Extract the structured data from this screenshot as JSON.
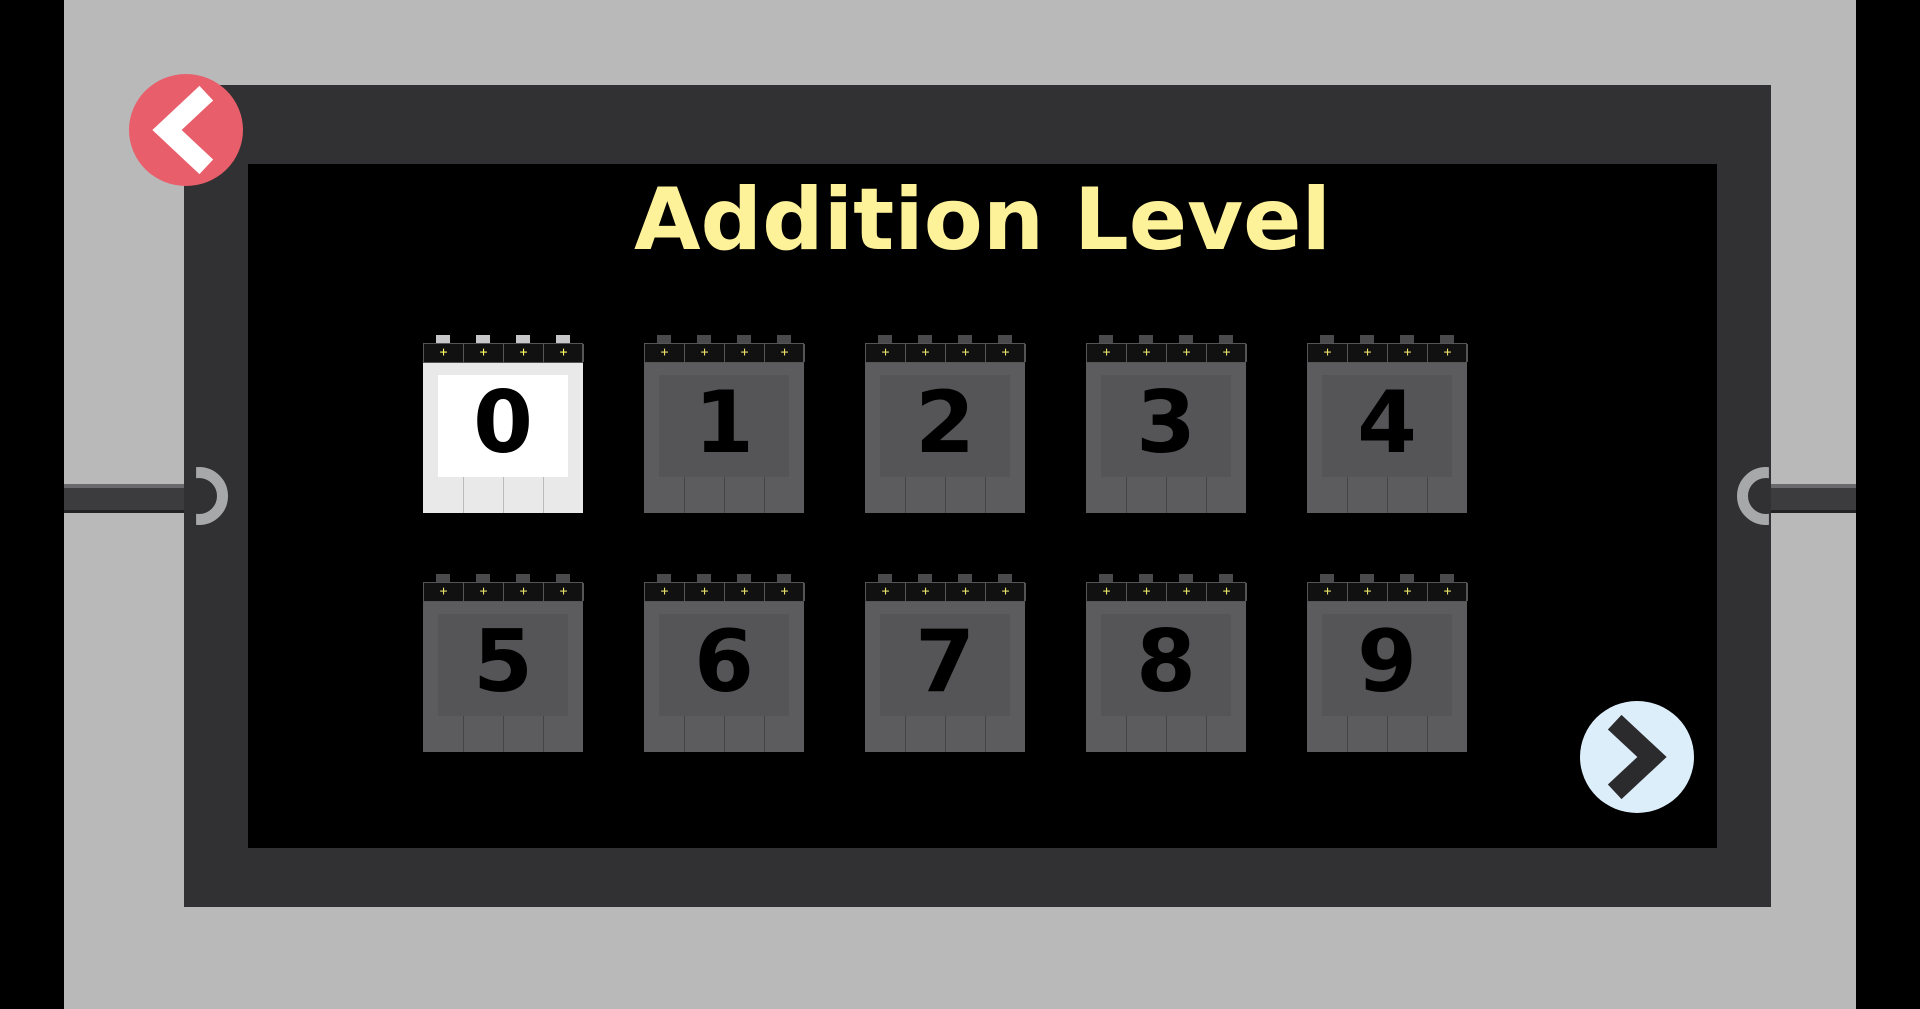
{
  "title": "Addition Level",
  "back_button": {
    "icon": "chevron-left-icon"
  },
  "next_button": {
    "icon": "chevron-right-icon"
  },
  "level_tiles": [
    {
      "number": "0",
      "state": "selected",
      "operators": [
        "+",
        "+",
        "+",
        "+"
      ]
    },
    {
      "number": "1",
      "state": "default",
      "operators": [
        "+",
        "+",
        "+",
        "+"
      ]
    },
    {
      "number": "2",
      "state": "default",
      "operators": [
        "+",
        "+",
        "+",
        "+"
      ]
    },
    {
      "number": "3",
      "state": "default",
      "operators": [
        "+",
        "+",
        "+",
        "+"
      ]
    },
    {
      "number": "4",
      "state": "default",
      "operators": [
        "+",
        "+",
        "+",
        "+"
      ]
    },
    {
      "number": "5",
      "state": "default",
      "operators": [
        "+",
        "+",
        "+",
        "+"
      ]
    },
    {
      "number": "6",
      "state": "default",
      "operators": [
        "+",
        "+",
        "+",
        "+"
      ]
    },
    {
      "number": "7",
      "state": "default",
      "operators": [
        "+",
        "+",
        "+",
        "+"
      ]
    },
    {
      "number": "8",
      "state": "default",
      "operators": [
        "+",
        "+",
        "+",
        "+"
      ]
    },
    {
      "number": "9",
      "state": "default",
      "operators": [
        "+",
        "+",
        "+",
        "+"
      ]
    }
  ],
  "colors": {
    "title": "#fdf19a",
    "back_button": "#e85f6b",
    "next_button": "#ddeefb",
    "frame": "#313133",
    "background": "#b9b9b9"
  }
}
